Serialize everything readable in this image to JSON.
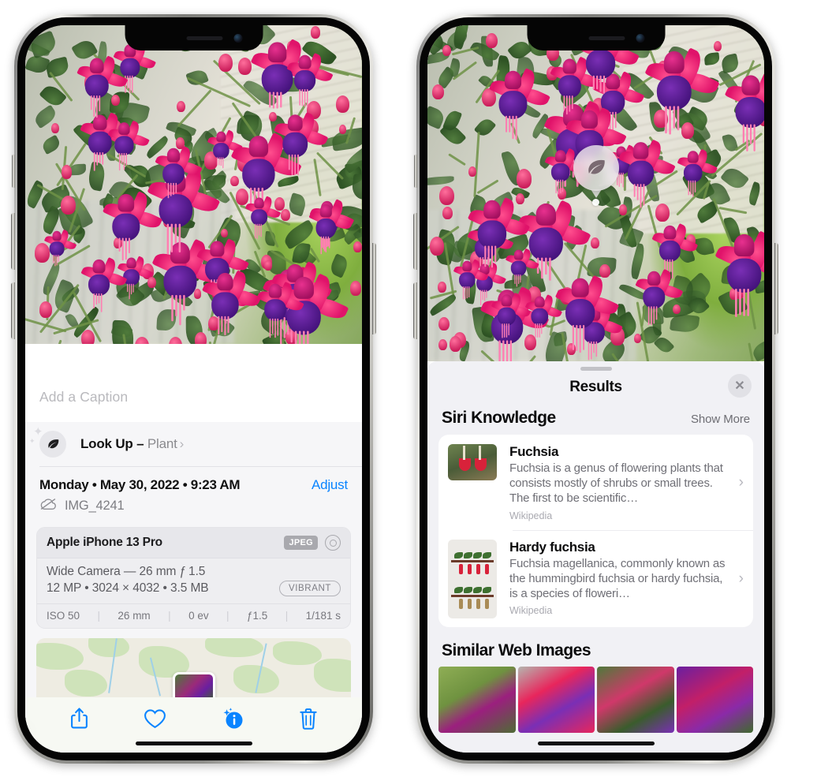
{
  "left_phone": {
    "caption_placeholder": "Add a Caption",
    "lookup": {
      "icon": "leaf-icon",
      "label": "Look Up",
      "dash": "–",
      "category": "Plant",
      "chevron": "›"
    },
    "date": "Monday • May 30, 2022 • 9:23 AM",
    "adjust_label": "Adjust",
    "filename": "IMG_4241",
    "filename_icon": "cloud-slash-icon",
    "exif": {
      "model": "Apple iPhone 13 Pro",
      "format_badge": "JPEG",
      "raw_icon": "raw-capture-icon",
      "lens_line": "Wide Camera — 26 mm ƒ 1.5",
      "size_line": "12 MP • 3024 × 4032 • 3.5 MB",
      "style_badge": "VIBRANT",
      "stats": [
        "ISO 50",
        "26 mm",
        "0 ev",
        "ƒ1.5",
        "1/181 s"
      ]
    },
    "toolbar": [
      {
        "name": "share-icon",
        "label": "Share"
      },
      {
        "name": "heart-icon",
        "label": "Favorite"
      },
      {
        "name": "info-sparkle-icon",
        "label": "Info"
      },
      {
        "name": "trash-icon",
        "label": "Delete"
      }
    ]
  },
  "right_phone": {
    "visual_lookup_badge": "leaf-icon",
    "sheet_title": "Results",
    "close_label": "✕",
    "siri_knowledge": {
      "title": "Siri Knowledge",
      "show_more": "Show More",
      "items": [
        {
          "title": "Fuchsia",
          "description": "Fuchsia is a genus of flowering plants that consists mostly of shrubs or small trees. The first to be scientific…",
          "source": "Wikipedia"
        },
        {
          "title": "Hardy fuchsia",
          "description": "Fuchsia magellanica, commonly known as the hummingbird fuchsia or hardy fuchsia, is a species of floweri…",
          "source": "Wikipedia"
        }
      ]
    },
    "similar_web_images": {
      "title": "Similar Web Images",
      "count": 4
    }
  },
  "colors": {
    "accent_blue": "#0a84ff",
    "sheet_bg": "#f1f1f5",
    "card_bg": "#ffffff",
    "secondary_text": "#6f6f76"
  }
}
